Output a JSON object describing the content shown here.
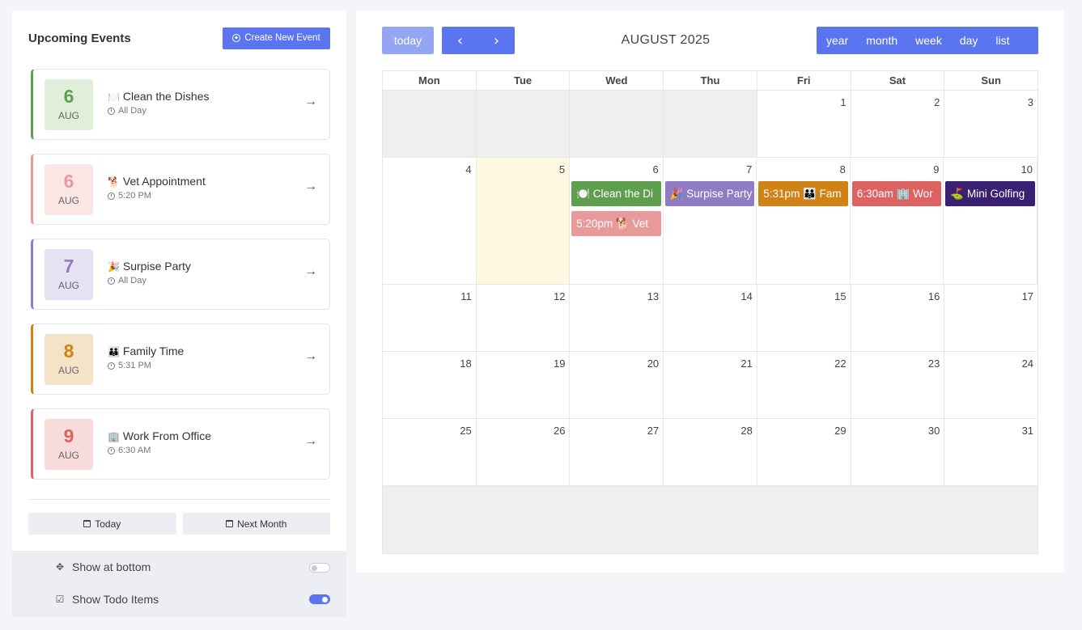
{
  "sidebar": {
    "title": "Upcoming Events",
    "create_label": "Create New Event",
    "events": [
      {
        "day": "6",
        "month": "AUG",
        "emoji": "🍽️",
        "name": "Clean the Dishes",
        "time": "All Day",
        "accent": "#5e9e4e",
        "bg": "#e0efd9",
        "daycolor": "#5e9e4e"
      },
      {
        "day": "6",
        "month": "AUG",
        "emoji": "🐕",
        "name": "Vet Appointment",
        "time": "5:20 PM",
        "accent": "#e89a9a",
        "bg": "#fbe6e6",
        "daycolor": "#e89a9a"
      },
      {
        "day": "7",
        "month": "AUG",
        "emoji": "🎉",
        "name": "Surpise Party",
        "time": "All Day",
        "accent": "#8f7cc4",
        "bg": "#e6e1f3",
        "daycolor": "#8f7cc4"
      },
      {
        "day": "8",
        "month": "AUG",
        "emoji": "👪",
        "name": "Family Time",
        "time": "5:31 PM",
        "accent": "#d08214",
        "bg": "#f5e3c8",
        "daycolor": "#d08214"
      },
      {
        "day": "9",
        "month": "AUG",
        "emoji": "🏢",
        "name": "Work From Office",
        "time": "6:30 AM",
        "accent": "#dd6363",
        "bg": "#f8dcdc",
        "daycolor": "#dd6363"
      }
    ],
    "today_label": "Today",
    "next_month_label": "Next Month",
    "show_at_bottom_label": "Show at bottom",
    "show_todo_label": "Show Todo Items"
  },
  "calendar": {
    "today_label": "today",
    "prev_icon": "‹",
    "next_icon": "›",
    "title": "AUGUST 2025",
    "views": [
      "year",
      "month",
      "week",
      "day",
      "list"
    ],
    "dow": [
      "Mon",
      "Tue",
      "Wed",
      "Thu",
      "Fri",
      "Sat",
      "Sun"
    ],
    "weeks": [
      [
        "",
        "",
        "",
        "",
        "1",
        "2",
        "3"
      ],
      [
        "4",
        "5",
        "6",
        "7",
        "8",
        "9",
        "10"
      ],
      [
        "11",
        "12",
        "13",
        "14",
        "15",
        "16",
        "17"
      ],
      [
        "18",
        "19",
        "20",
        "21",
        "22",
        "23",
        "24"
      ],
      [
        "25",
        "26",
        "27",
        "28",
        "29",
        "30",
        "31"
      ]
    ],
    "week_events": [
      {
        "col": 2,
        "row": 0,
        "text": "🍽️ Clean the Di",
        "color": "#5e9e4e"
      },
      {
        "col": 3,
        "row": 0,
        "text": "🎉 Surpise Party",
        "color": "#8f7cc4"
      },
      {
        "col": 4,
        "row": 0,
        "text": "5:31pm 👪 Fam",
        "color": "#d08214"
      },
      {
        "col": 5,
        "row": 0,
        "text": "6:30am 🏢 Wor",
        "color": "#dd6363"
      },
      {
        "col": 6,
        "row": 0,
        "text": "⛳ Mini Golfing",
        "color": "#3a1f72"
      },
      {
        "col": 2,
        "row": 1,
        "text": "5:20pm 🐕 Vet",
        "color": "#e89a9a"
      }
    ]
  }
}
